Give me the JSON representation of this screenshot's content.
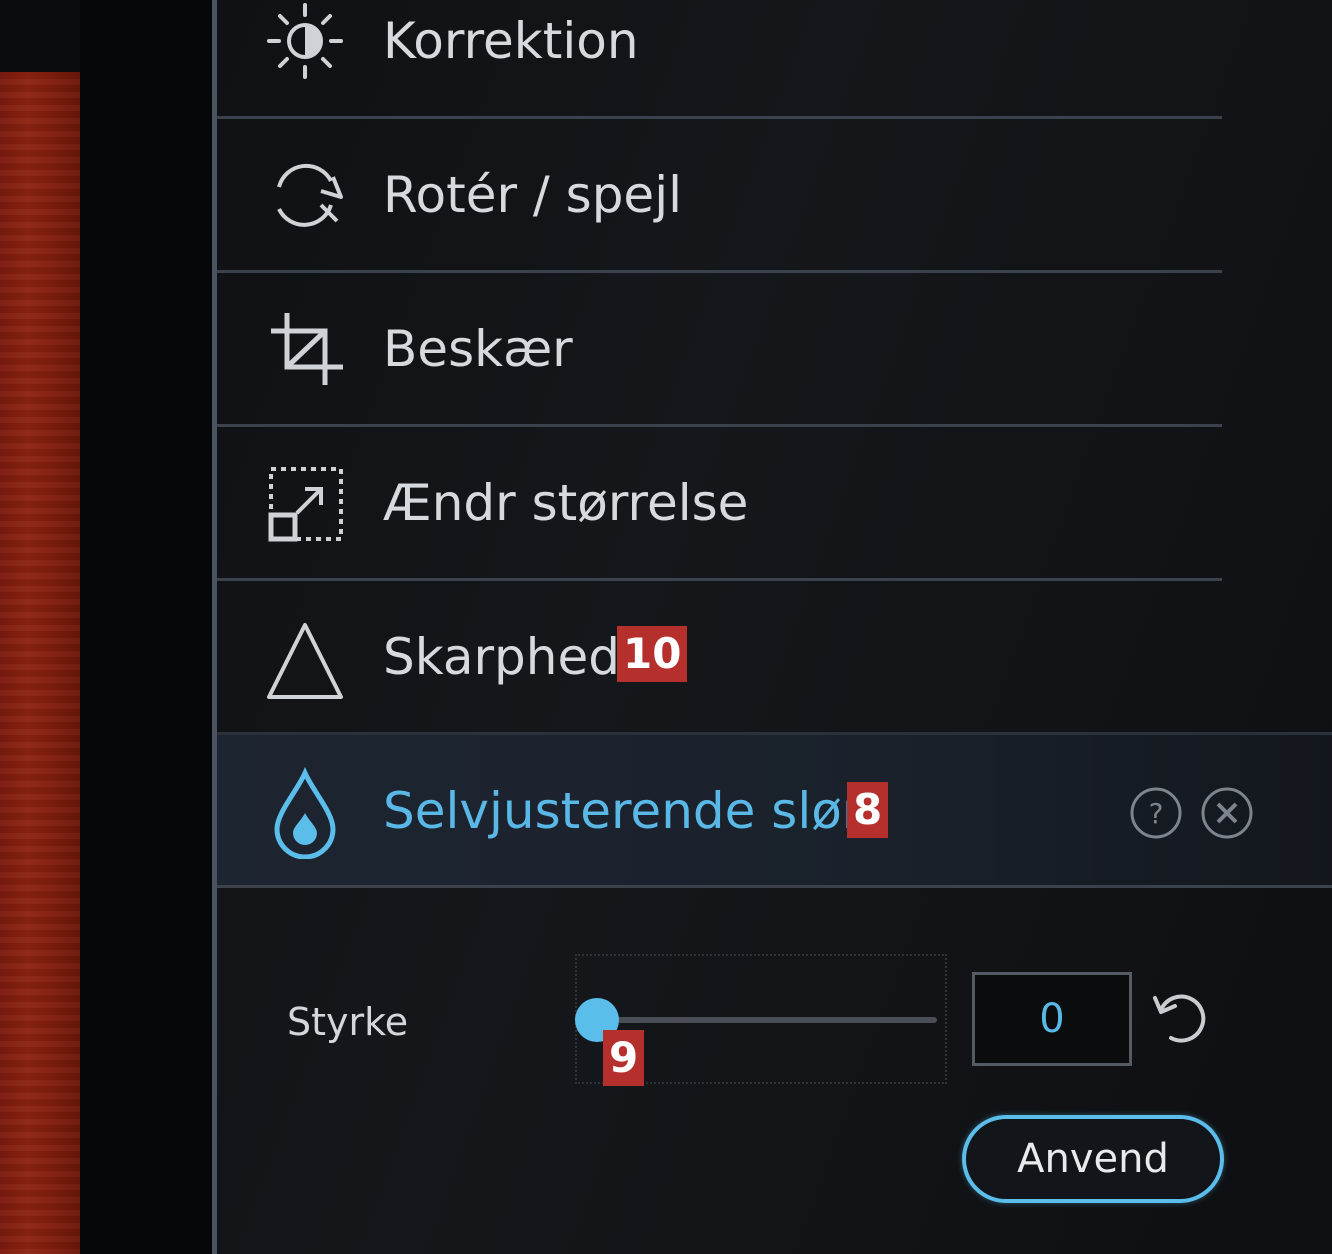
{
  "menu": {
    "items": [
      {
        "label": "Korrektion",
        "icon": "brightness-icon"
      },
      {
        "label": "Rotér / spejl",
        "icon": "rotate-icon"
      },
      {
        "label": "Beskær",
        "icon": "crop-icon"
      },
      {
        "label": "Ændr størrelse",
        "icon": "resize-icon"
      },
      {
        "label": "Skarphed",
        "icon": "sharpen-icon",
        "badge": "10"
      },
      {
        "label": "Selvjusterende slør",
        "icon": "blur-drop-icon",
        "badge": "8",
        "active": true
      }
    ]
  },
  "settings": {
    "strength_label": "Styrke",
    "strength_value": "0",
    "strength_level": 0,
    "slider_badge": "9",
    "apply_label": "Anvend"
  },
  "colors": {
    "accent": "#5bbde9",
    "badge": "#b5302c",
    "text": "#d6d9de",
    "photo": "#8c2312"
  }
}
